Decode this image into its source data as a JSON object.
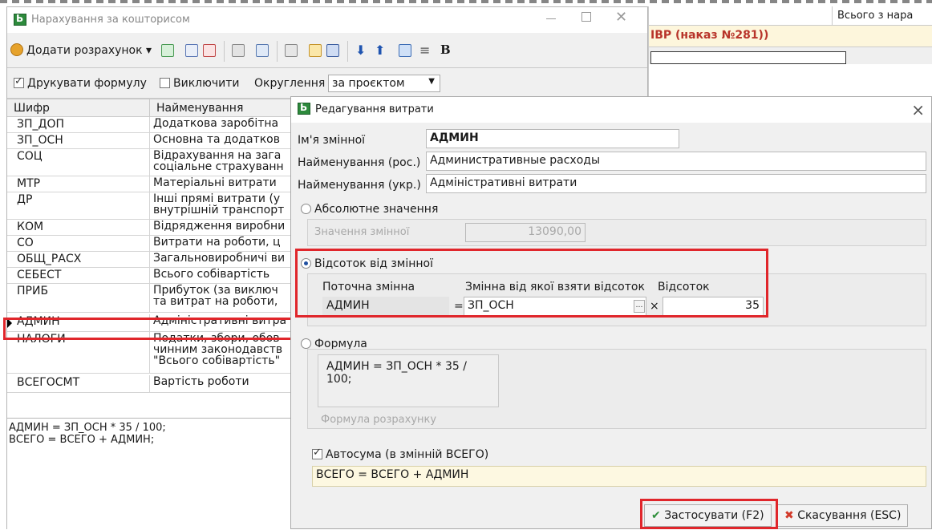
{
  "bg_window": {
    "header_cell": "Всього з нара",
    "highlight_text": "ІВР (наказ №281))"
  },
  "main_window": {
    "title": "Нарахування за кошторисом",
    "toolbar": {
      "add_label": "Додати розрахунок",
      "add_dropdown": "▾",
      "bold_label": "B"
    },
    "options": {
      "print_formula_label": "Друкувати формулу",
      "exclude_label": "Виключити",
      "rounding_label": "Округлення",
      "rounding_value": "за проєктом"
    },
    "table": {
      "col_code": "Шифр",
      "col_name": "Найменування",
      "rows": [
        {
          "code": "ЗП_ДОП",
          "name": "Додаткова заробітна"
        },
        {
          "code": "ЗП_ОСН",
          "name": "Основна та додатков"
        },
        {
          "code": "СОЦ",
          "name": "Відрахування на зага",
          "name2": "соціальне страхуванн"
        },
        {
          "code": "МТР",
          "name": "Матеріальні витрати"
        },
        {
          "code": "ДР",
          "name": "Інші прямі витрати (у",
          "name2": "внутрішній транспорт"
        },
        {
          "code": "КОМ",
          "name": "Відрядження виробни"
        },
        {
          "code": "СО",
          "name": "Витрати на роботи, ц"
        },
        {
          "code": "ОБЩ_РАСХ",
          "name": "Загальновиробничі ви"
        },
        {
          "code": "СЕБЕСТ",
          "name": "Всього собівартість"
        },
        {
          "code": "ПРИБ",
          "name": "Прибуток (за виключ",
          "name2": "та витрат на роботи,"
        },
        {
          "code": "АДМИН",
          "name": "Адміністративні витра"
        },
        {
          "code": "НАЛОГИ",
          "name": "Податки, збори, обов",
          "name2": "чинним законодавств",
          "name3": "\"Всього собівартість\""
        },
        {
          "code": "ВСЕГОСМТ",
          "name": "Вартість роботи"
        }
      ]
    },
    "memo_lines": [
      "АДМИН = ЗП_ОСН  * 35 / 100;",
      "ВСЕГО = ВСЕГО + АДМИН;"
    ]
  },
  "dialog": {
    "title": "Редагування витрати",
    "var_name_label": "Ім'я змінної",
    "var_name_value": "АДМИН",
    "name_ru_label": "Найменування (рос.)",
    "name_ru_value": "Административные расходы",
    "name_uk_label": "Найменування (укр.)",
    "name_uk_value": "Адміністративні витрати",
    "abs_label": "Абсолютне значення",
    "abs_value_label": "Значення змінної",
    "abs_value": "13090,00",
    "percent_label": "Відсоток від змінної",
    "current_var_label": "Поточна змінна",
    "current_var_value": "АДМИН",
    "source_var_label": "Змінна від якої взяти відсоток",
    "source_var_value": "ЗП_ОСН",
    "percent_col_label": "Відсоток",
    "percent_value": "35",
    "eq_sign": "=",
    "times_sign": "×",
    "formula_label": "Формула",
    "formula_text": "АДМИН = ЗП_ОСН  * 35 / 100;",
    "formula_hint": "Формула розрахунку",
    "autosum_label": "Автосума (в змінній ВСЕГО)",
    "autosum_text": "ВСЕГО = ВСЕГО + АДМИН",
    "apply_label": "Застосувати (F2)",
    "cancel_label": "Скасування (ESC)"
  },
  "colors": {
    "highlight": "#e0262b",
    "accent_green": "#2d8a3c",
    "autosum_bg": "#fdf8e1"
  }
}
